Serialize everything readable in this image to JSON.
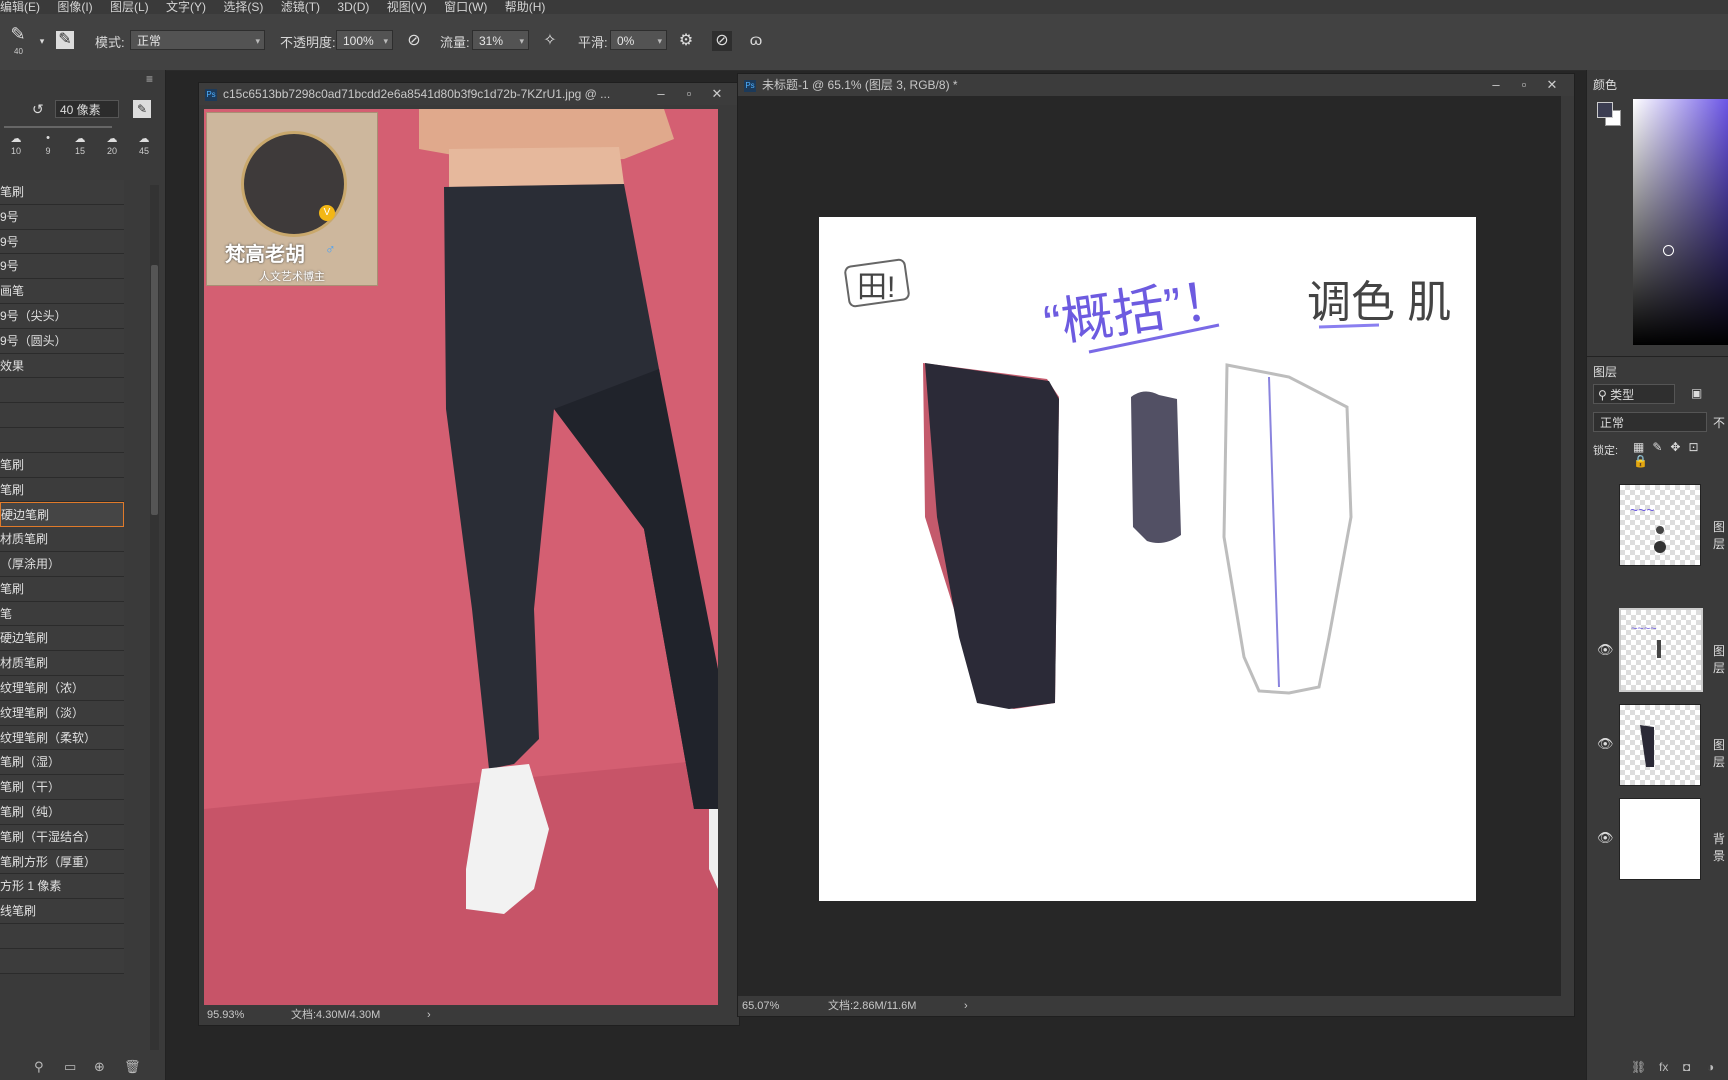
{
  "menu": [
    "编辑(E)",
    "图像(I)",
    "图层(L)",
    "文字(Y)",
    "选择(S)",
    "滤镜(T)",
    "3D(D)",
    "视图(V)",
    "窗口(W)",
    "帮助(H)"
  ],
  "options": {
    "brush_size": "40",
    "mode_label": "模式:",
    "mode_value": "正常",
    "opacity_label": "不透明度:",
    "opacity_value": "100%",
    "flow_label": "流量:",
    "flow_value": "31%",
    "smoothing_label": "平滑:",
    "smoothing_value": "0%"
  },
  "brush_panel": {
    "size_value": "40 像素",
    "presets": [
      "10",
      "9",
      "15",
      "20",
      "45"
    ],
    "items": [
      "笔刷",
      "9号",
      "9号",
      "9号",
      "画笔",
      "9号（尖头）",
      "9号（圆头）",
      "效果",
      "",
      "",
      "",
      "笔刷",
      "笔刷",
      "硬边笔刷",
      "材质笔刷",
      "（厚涂用）",
      "笔刷",
      "笔",
      "硬边笔刷",
      "材质笔刷",
      "纹理笔刷（浓）",
      "纹理笔刷（淡）",
      "纹理笔刷（柔软）",
      "笔刷（湿）",
      "笔刷（干）",
      "笔刷（纯）",
      "笔刷（干湿结合）",
      "笔刷方形（厚重）",
      "方形 1 像素",
      "线笔刷",
      "",
      ""
    ]
  },
  "doc1": {
    "title": "c15c6513bb7298c0ad71bcdd2e6a8541d80b3f9c1d72b-7KZrU1.jpg @ ...",
    "zoom": "95.93%",
    "docsize": "文档:4.30M/4.30M",
    "avatar_name": "梵高老胡",
    "avatar_sub": "人文艺术博主",
    "badge": "V"
  },
  "doc2": {
    "title": "未标题-1 @ 65.1% (图层 3, RGB/8) *",
    "zoom": "65.07%",
    "docsize": "文档:2.86M/11.6M",
    "handwriting": {
      "circle": "田!",
      "quote": "“概括”！",
      "right": "调色 肌"
    }
  },
  "right_panel": {
    "color_tab": "颜色",
    "layers_tab": "图层",
    "filter_label": "类型",
    "blend_mode": "正常",
    "lock_label": "锁定:",
    "opacity_short": "不",
    "layers": [
      {
        "name": "图层",
        "visible": false
      },
      {
        "name": "图层",
        "visible": true
      },
      {
        "name": "图层",
        "visible": true
      },
      {
        "name": "背景",
        "visible": true
      }
    ]
  }
}
